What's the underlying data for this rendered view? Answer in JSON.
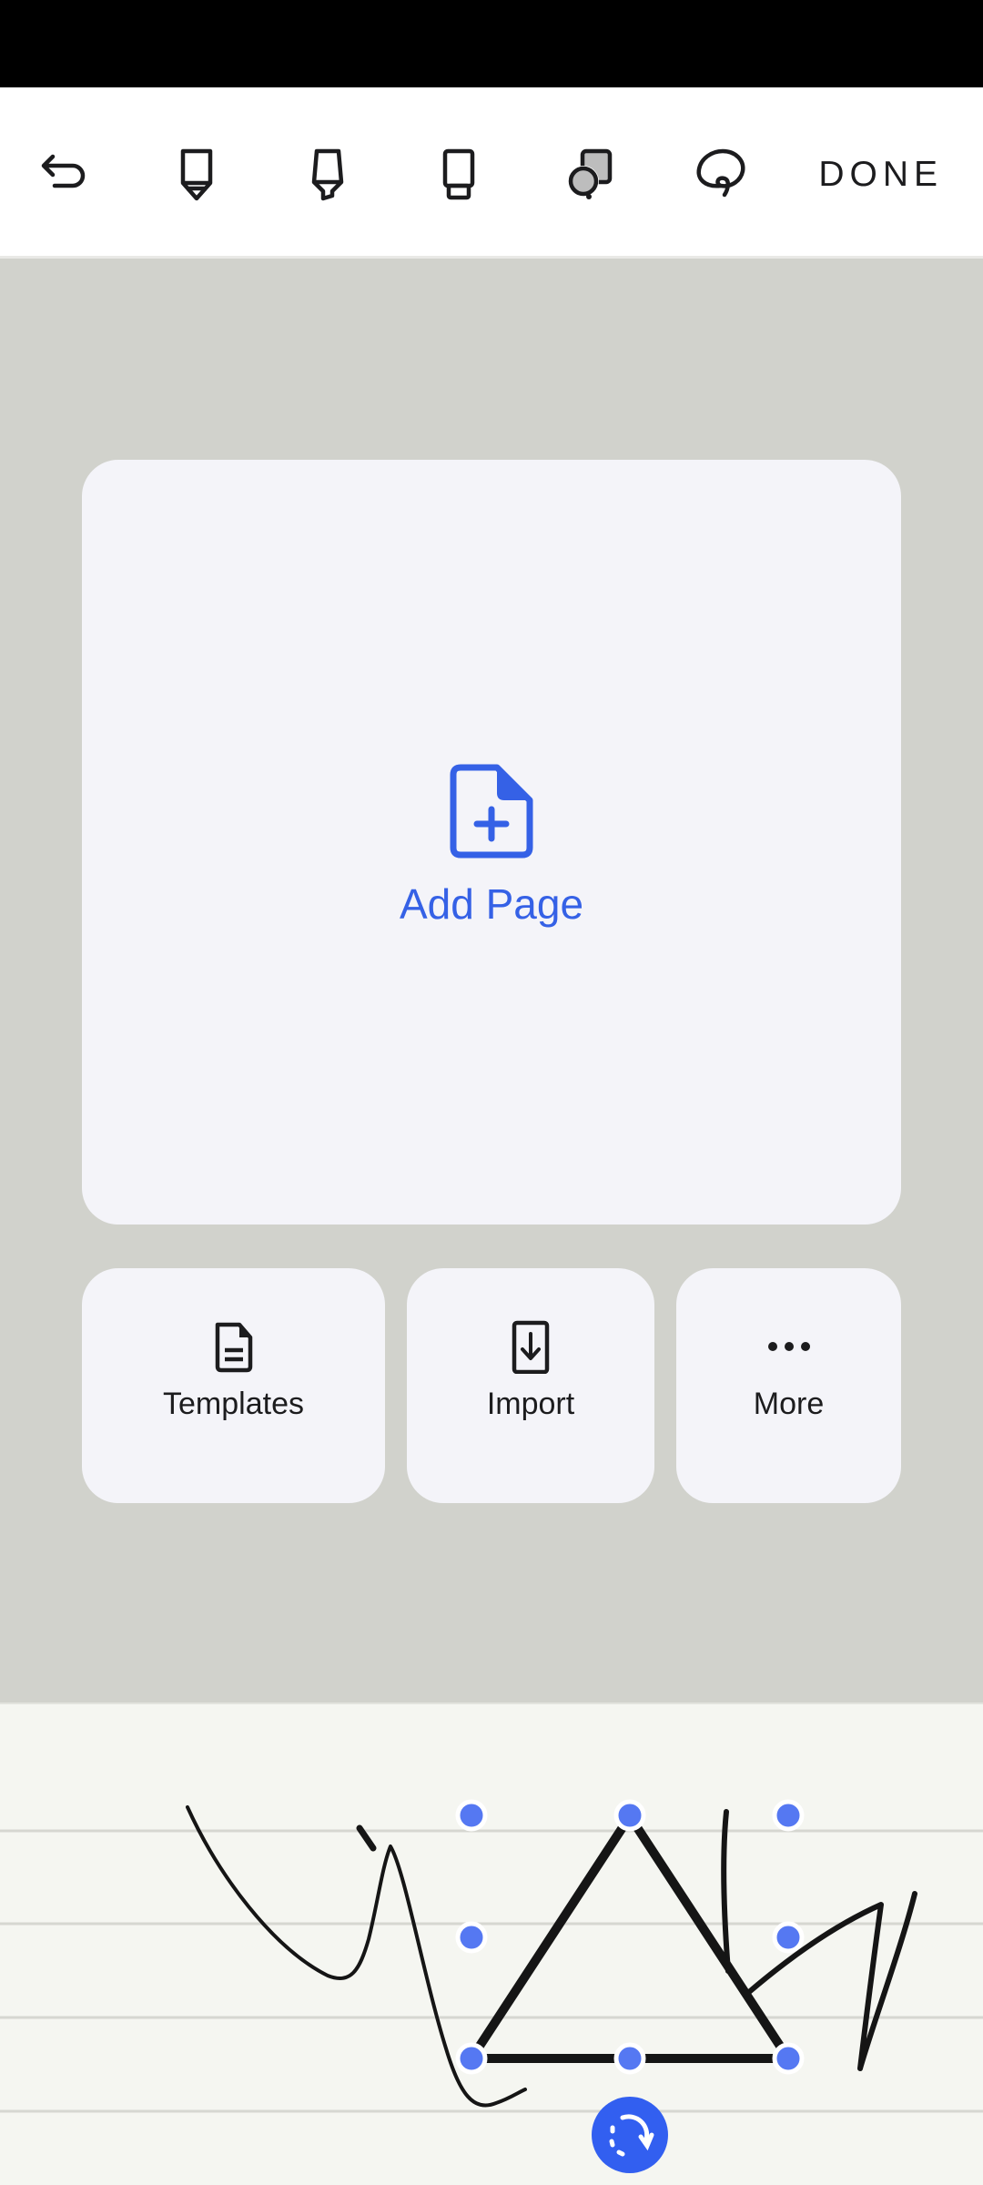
{
  "toolbar": {
    "tools": [
      {
        "name": "undo-icon",
        "label": "Undo"
      },
      {
        "name": "pen-icon",
        "label": "Pen"
      },
      {
        "name": "highlighter-icon",
        "label": "Highlighter"
      },
      {
        "name": "eraser-icon",
        "label": "Eraser"
      },
      {
        "name": "shapes-icon",
        "label": "Shapes"
      },
      {
        "name": "lasso-icon",
        "label": "Lasso"
      }
    ],
    "done_label": "DONE"
  },
  "add_page": {
    "label": "Add Page",
    "icon": "file-plus-icon"
  },
  "actions": [
    {
      "label": "Templates",
      "icon": "document-icon"
    },
    {
      "label": "Import",
      "icon": "import-icon"
    },
    {
      "label": "More",
      "icon": "more-horizontal-icon"
    }
  ],
  "colors": {
    "accent": "#3561e6",
    "handle": "#5578f2",
    "canvas_bg": "#d1d2cc",
    "card_bg": "#f4f4f9",
    "paper_bg": "#f5f6f1",
    "ink": "#151515"
  },
  "selection": {
    "shape": "triangle",
    "rotate_icon": "rotate-icon"
  }
}
